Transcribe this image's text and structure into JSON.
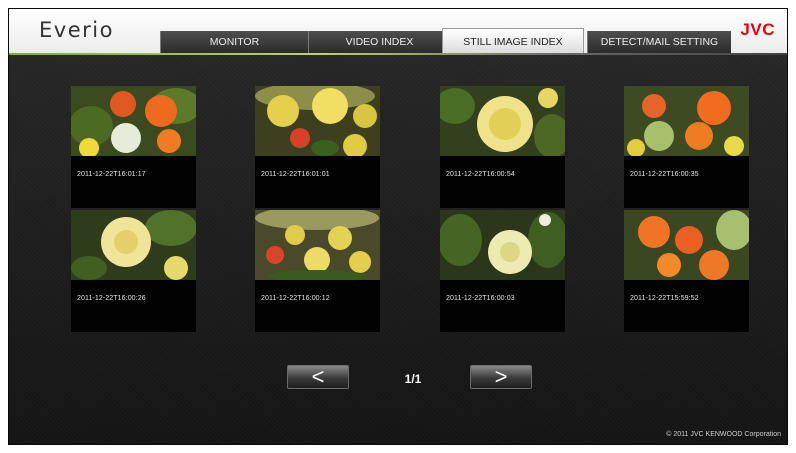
{
  "app": {
    "brand": "Everio",
    "logo": "JVC"
  },
  "tabs": [
    {
      "label": "MONITOR",
      "active": false
    },
    {
      "label": "VIDEO INDEX",
      "active": false
    },
    {
      "label": "STILL IMAGE INDEX",
      "active": true
    },
    {
      "label": "DETECT/MAIL SETTING",
      "active": false
    }
  ],
  "thumbnails": [
    {
      "timestamp": "2011-12-22T16:01:17",
      "subject": "red and orange roses with white chrysanthemum"
    },
    {
      "timestamp": "2011-12-22T16:01:01",
      "subject": "yellow roses with red flowers"
    },
    {
      "timestamp": "2011-12-22T16:00:54",
      "subject": "large yellow rose"
    },
    {
      "timestamp": "2011-12-22T16:00:35",
      "subject": "orange roses with green hydrangea"
    },
    {
      "timestamp": "2011-12-22T16:00:26",
      "subject": "yellow rose close-up"
    },
    {
      "timestamp": "2011-12-22T16:00:12",
      "subject": "yellow roses bouquet"
    },
    {
      "timestamp": "2011-12-22T16:00:03",
      "subject": "pale yellow rose among leaves"
    },
    {
      "timestamp": "2011-12-22T15:59:52",
      "subject": "orange roses"
    }
  ],
  "pagination": {
    "prev_label": "<",
    "next_label": ">",
    "page": "1/1"
  },
  "footer": {
    "copyright": "© 2011 JVC KENWOOD Corporation"
  },
  "colors": {
    "accent": "#e60012",
    "header_line": "#8fbf3a",
    "background": "#1b1b1b"
  },
  "icons": {
    "prev": "chevron-left-icon",
    "next": "chevron-right-icon"
  }
}
